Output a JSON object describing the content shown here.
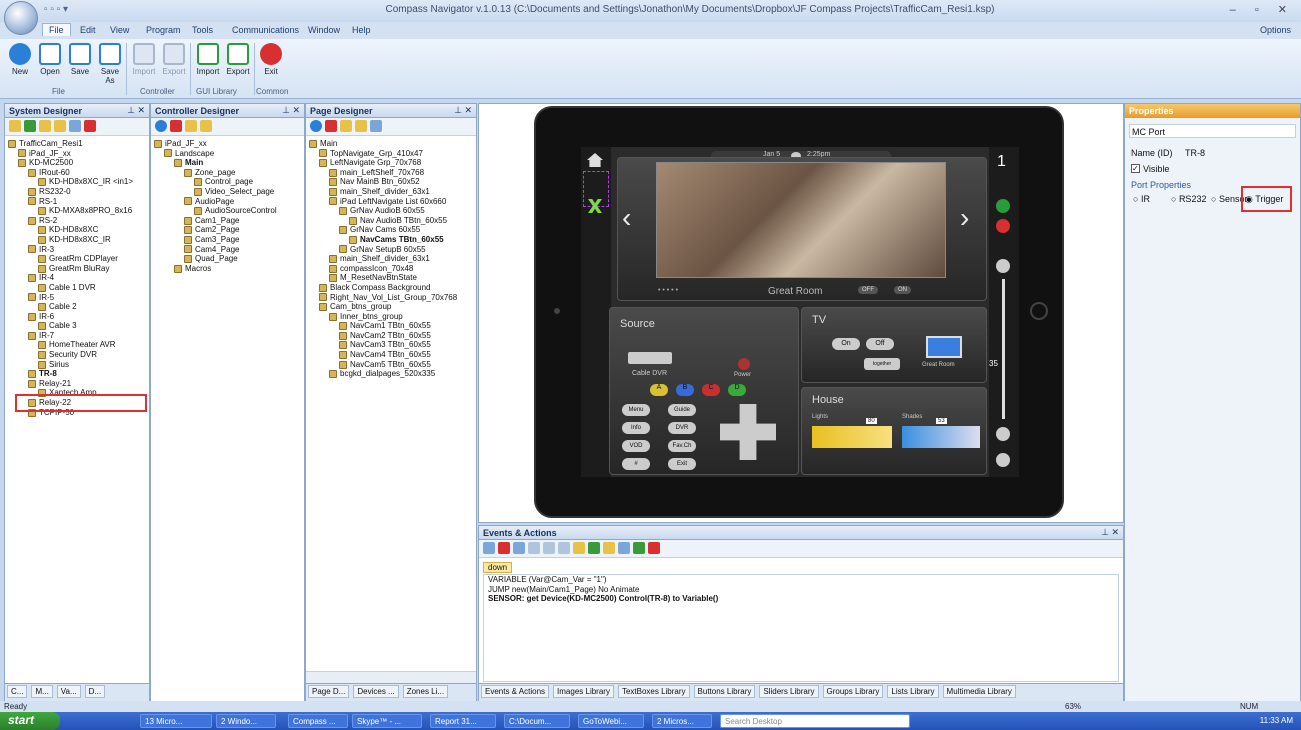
{
  "window": {
    "title": "Compass Navigator  v.1.0.13 (C:\\Documents and Settings\\Jonathon\\My Documents\\Dropbox\\JF Compass Projects\\TrafficCam_Resi1.ksp)"
  },
  "menu": {
    "tabs": [
      "File",
      "Edit",
      "View",
      "Program",
      "Tools",
      "Communications",
      "Window",
      "Help"
    ],
    "options": "Options"
  },
  "ribbon": {
    "buttons": [
      "New",
      "Open",
      "Save",
      "Save As",
      "Import",
      "Export",
      "Import",
      "Export",
      "Exit"
    ],
    "groups": [
      "File",
      "Controller",
      "GUI Library",
      "Common"
    ]
  },
  "system_designer": {
    "title": "System Designer",
    "nodes": [
      "TrafficCam_Resi1",
      "iPad_JF_xx",
      "KD-MC2500",
      "IRout-60",
      "KD-HD8x8XC_IR <in1>",
      "RS232-0",
      "RS-1",
      "KD-MXA8x8PRO_8x16",
      "RS-2",
      "KD-HD8x8XC",
      "KD-HD8x8XC_IR",
      "IR-3",
      "GreatRm CDPlayer",
      "GreatRm BluRay",
      "IR-4",
      "Cable 1 DVR",
      "IR-5",
      "Cable 2",
      "IR-6",
      "Cable 3",
      "IR-7",
      "HomeTheater AVR",
      "Security DVR",
      "Sirius",
      "TR-8",
      "Relay-21",
      "Xantech Amp",
      "Relay-22",
      "TCPIP-50"
    ],
    "tabs": [
      "C...",
      "M...",
      "Va...",
      "D..."
    ]
  },
  "controller_designer": {
    "title": "Controller Designer",
    "nodes": [
      "iPad_JF_xx",
      "Landscape",
      "Main",
      "Zone_page",
      "Control_page",
      "Video_Select_page",
      "AudioPage",
      "AudioSourceControl",
      "Cam1_Page",
      "Cam2_Page",
      "Cam3_Page",
      "Cam4_Page",
      "Quad_Page",
      "Macros"
    ]
  },
  "page_designer": {
    "title": "Page Designer",
    "nodes": [
      "Main",
      "TopNavigate_Grp_410x47",
      "LeftNavigate Grp_70x768",
      "main_LeftShelf_70x768",
      "Nav MainB Btn_60x52",
      "main_Shelf_divider_63x1",
      "iPad LeftNavigate List 60x660",
      "GrNav AudioB 60x55",
      "Nav AudioB TBtn_60x55",
      "GrNav Cams 60x55",
      "NavCams TBtn_60x55",
      "GrNav SetupB 60x55",
      "main_Shelf_divider_63x1",
      "compassIcon_70x48",
      "M_ResetNavBtnState",
      "Black Compass Background",
      "Right_Nav_Vol_List_Group_70x768",
      "Cam_btns_group",
      "Inner_btns_group",
      "NavCam1 TBtn_60x55",
      "NavCam2 TBtn_60x55",
      "NavCam3 TBtn_60x55",
      "NavCam4 TBtn_60x55",
      "NavCam5 TBtn_60x55",
      "bcgkd_dialpages_520x335"
    ],
    "tabs": [
      "Page D...",
      "Devices ...",
      "Zones Li..."
    ]
  },
  "ipad": {
    "date": "Jan 5",
    "time": "2:25pm",
    "room": "Great Room",
    "page_num": "1",
    "off": "OFF",
    "on": "ON",
    "source_title": "Source",
    "source_device": "Cable DVR",
    "power": "Power",
    "abcd": [
      "A",
      "B",
      "C",
      "D"
    ],
    "keys": [
      "Menu",
      "Guide",
      "Info",
      "DVR",
      "VOD",
      "Fav.Ch",
      "#",
      "Exit"
    ],
    "tv_title": "TV",
    "tv_on": "On",
    "tv_off": "Off",
    "together": "together",
    "tv_room": "Great Room",
    "house_title": "House",
    "lights": "Lights",
    "shades": "Shades",
    "lights_val": "80",
    "shades_val": "53",
    "vol": "35"
  },
  "events": {
    "title": "Events & Actions",
    "tab": "down",
    "lines": [
      "VARIABLE (Var@Cam_Var = \"1\")",
      "JUMP new(Main/Cam1_Page) No Animate",
      "SENSOR: get Device(KD-MC2500) Control(TR-8) to Variable()"
    ],
    "libs": [
      "Events & Actions",
      "Images Library",
      "TextBoxes Library",
      "Buttons Library",
      "Sliders Library",
      "Groups Library",
      "Lists Library",
      "Multimedia Library"
    ]
  },
  "properties": {
    "title": "Properties",
    "type": "MC Port",
    "name_label": "Name (ID)",
    "name_value": "TR-8",
    "visible": "Visible",
    "port_props": "Port Properties",
    "radios": [
      "IR",
      "RS232",
      "Sensor",
      "Trigger"
    ]
  },
  "status": {
    "left": "Ready",
    "zoom": "63%",
    "num": "NUM"
  },
  "taskbar": {
    "start": "start",
    "items": [
      "13 Micro...",
      "2 Windo...",
      "Compass ...",
      "Skype™ - ...",
      "Report 31...",
      "C:\\Docum...",
      "GoToWebi...",
      "2 Micros..."
    ],
    "search": "Search Desktop",
    "clock": "11:33 AM"
  }
}
